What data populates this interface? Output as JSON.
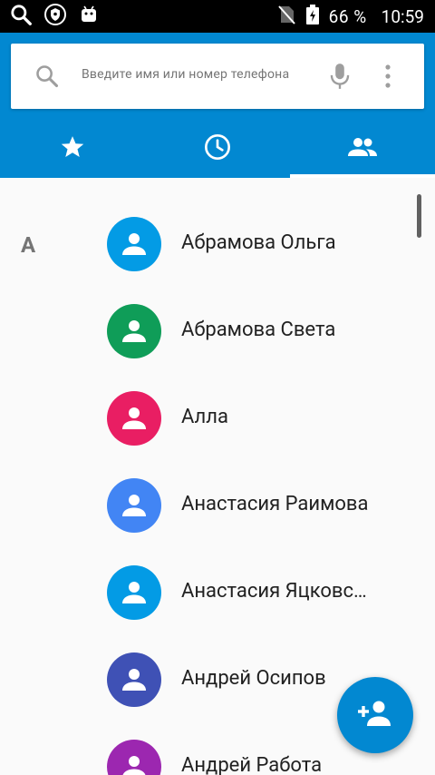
{
  "status_bar": {
    "battery_percent": "66 %",
    "time": "10:59",
    "icons": [
      "search-icon",
      "vpn-shield-icon",
      "android-debug-icon",
      "no-sim-icon",
      "battery-charging-icon"
    ]
  },
  "search": {
    "placeholder": "Введите имя или номер телефона"
  },
  "tabs": [
    {
      "icon": "star-icon",
      "name": "favorites",
      "selected": false
    },
    {
      "icon": "clock-icon",
      "name": "recents",
      "selected": false
    },
    {
      "icon": "people-icon",
      "name": "contacts",
      "selected": true
    }
  ],
  "colors": {
    "app_bar": "#0288d1",
    "fab": "#0288d1"
  },
  "contacts": {
    "section_letter": "А",
    "items": [
      {
        "name": "Абрамова Ольга",
        "color": "#039be5"
      },
      {
        "name": "Абрамова Света",
        "color": "#0f9d58"
      },
      {
        "name": "Алла",
        "color": "#e91e63"
      },
      {
        "name": "Анастасия Раимова",
        "color": "#4285f4"
      },
      {
        "name": "Анастасия Яцковс…",
        "color": "#039be5"
      },
      {
        "name": "Андрей Осипов",
        "color": "#3f51b5"
      },
      {
        "name": "Андрей Работа",
        "color": "#9c27b0"
      }
    ]
  },
  "fab": {
    "icon": "add-person-icon"
  }
}
